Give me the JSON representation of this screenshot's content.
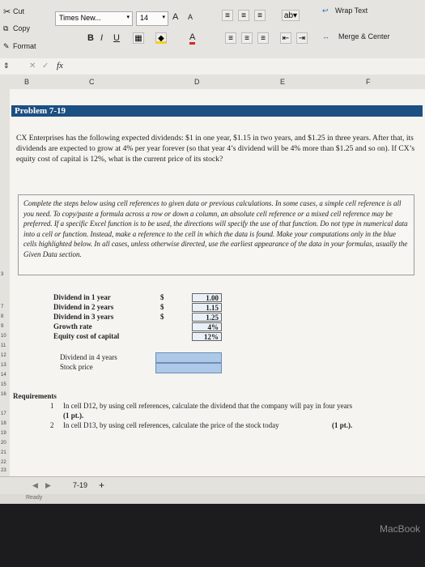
{
  "ribbon": {
    "cut": "Cut",
    "copy": "Copy",
    "format": "Format",
    "font_name": "Times New...",
    "font_size": "14",
    "grow": "A",
    "shrink": "A",
    "bold": "B",
    "italic": "I",
    "underline": "U",
    "font_color": "A",
    "wrap_text": "Wrap Text",
    "merge_center": "Merge & Center"
  },
  "formula_bar": {
    "cancel": "✕",
    "enter": "✓",
    "fx": "fx",
    "content": ""
  },
  "columns": [
    "B",
    "C",
    "D",
    "E",
    "F"
  ],
  "rows": [
    "3",
    "7",
    "8",
    "9",
    "10",
    "11",
    "12",
    "13",
    "14",
    "15",
    "16",
    "17",
    "18",
    "19",
    "20",
    "21",
    "22",
    "23"
  ],
  "sheet": {
    "title": "Problem 7-19",
    "problem_text": "CX Enterprises has the following expected dividends: $1 in one year, $1.15 in two years, and $1.25 in three years. After that, its dividends are expected to grow at 4% per year forever (so that year 4’s dividend will be 4% more than $1.25 and so on). If CX’s equity cost of capital is 12%, what is the current price of its stock?",
    "instructions": "Complete the steps below using cell references to given data or previous calculations. In some cases, a simple cell reference is all you need. To copy/paste a formula across a row or down a column, an absolute cell reference or a mixed cell reference may be preferred. If a specific Excel function is to be used, the directions will specify the use of that function. Do not type in numerical data into a cell or function. Instead, make a reference to the cell in which the data is found. Make your computations only in the blue cells highlighted below. In all cases, unless otherwise directed, use the earliest appearance of the data in your formulas, usually the Given Data section.",
    "given": [
      {
        "label": "Dividend in 1 year",
        "currency": "$",
        "value": "1.00"
      },
      {
        "label": "Dividend in 2 years",
        "currency": "$",
        "value": "1.15"
      },
      {
        "label": "Dividend in 3 years",
        "currency": "$",
        "value": "1.25"
      },
      {
        "label": "Growth rate",
        "currency": "",
        "value": "4%"
      },
      {
        "label": "Equity cost of capital",
        "currency": "",
        "value": "12%"
      }
    ],
    "outputs": [
      {
        "label": "Dividend in 4 years"
      },
      {
        "label": "Stock price"
      }
    ],
    "requirements_header": "Requirements",
    "requirements": [
      {
        "num": "1",
        "text": "In cell D12, by using cell references, calculate the dividend that the company will pay in four years",
        "points": "(1 pt.)."
      },
      {
        "num": "2",
        "text": "In cell D13, by using cell references, calculate the price of the stock today",
        "points": "(1 pt.)."
      }
    ]
  },
  "sheet_tab": "7-19",
  "add_sheet": "+",
  "status": "Ready",
  "laptop_brand": "MacBook"
}
